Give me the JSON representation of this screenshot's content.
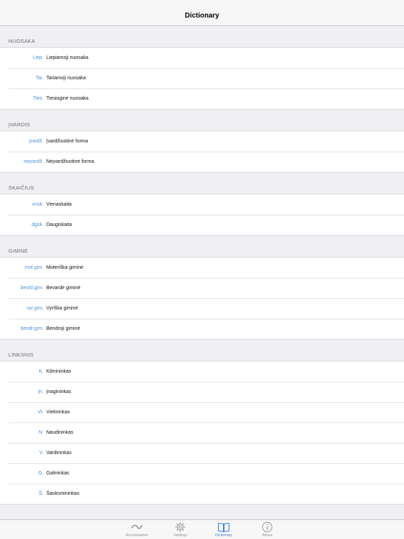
{
  "navbar": {
    "title": "Dictionary"
  },
  "sections": [
    {
      "header": "NUOSAKA",
      "rows": [
        {
          "abbr": "Liep.",
          "desc": "Liepiamoji nuosaka"
        },
        {
          "abbr": "Tar.",
          "desc": "Tariamoji nuosaka"
        },
        {
          "abbr": "Ties.",
          "desc": "Tiesioginė nuosaka"
        }
      ]
    },
    {
      "header": "ĮVARDIS",
      "rows": [
        {
          "abbr": "įvardž.",
          "desc": "Įvardžiuotinė forma"
        },
        {
          "abbr": "neįvardž.",
          "desc": "Neįvardžiuotinė forma"
        }
      ]
    },
    {
      "header": "SKAIČIUS",
      "rows": [
        {
          "abbr": "vnsk.",
          "desc": "Vienaskaita"
        },
        {
          "abbr": "dgsk.",
          "desc": "Daugiskaita"
        }
      ]
    },
    {
      "header": "GIMINĖ",
      "rows": [
        {
          "abbr": "mot.gim.",
          "desc": "Moteriška giminė"
        },
        {
          "abbr": "bevrd.gim.",
          "desc": "Bevardė giminė"
        },
        {
          "abbr": "vyr.gim.",
          "desc": "Vyriška giminė"
        },
        {
          "abbr": "bendr.gim.",
          "desc": "Bendroji giminė"
        }
      ]
    },
    {
      "header": "LINKSNIS",
      "rows": [
        {
          "abbr": "K.",
          "desc": "Kilmininkas"
        },
        {
          "abbr": "Įn.",
          "desc": "Įnagininkas"
        },
        {
          "abbr": "Vt.",
          "desc": "Vietininkas"
        },
        {
          "abbr": "N.",
          "desc": "Naudininkas"
        },
        {
          "abbr": "V.",
          "desc": "Vardininkas"
        },
        {
          "abbr": "G.",
          "desc": "Galininkas"
        },
        {
          "abbr": "Š.",
          "desc": "Šauksmininkas"
        }
      ]
    },
    {
      "header": "",
      "rows": []
    }
  ],
  "tabbar": {
    "tabs": [
      {
        "label": "Accentuation",
        "icon": "tilde-icon",
        "active": false
      },
      {
        "label": "Settings",
        "icon": "gear-icon",
        "active": false
      },
      {
        "label": "Dictionary",
        "icon": "book-icon",
        "active": true
      },
      {
        "label": "About",
        "icon": "info-icon",
        "active": false
      }
    ],
    "active_color": "#3a84d8",
    "inactive_color": "#929292"
  },
  "colors": {
    "abbr": "#4a90d9",
    "background": "#efeff4"
  }
}
